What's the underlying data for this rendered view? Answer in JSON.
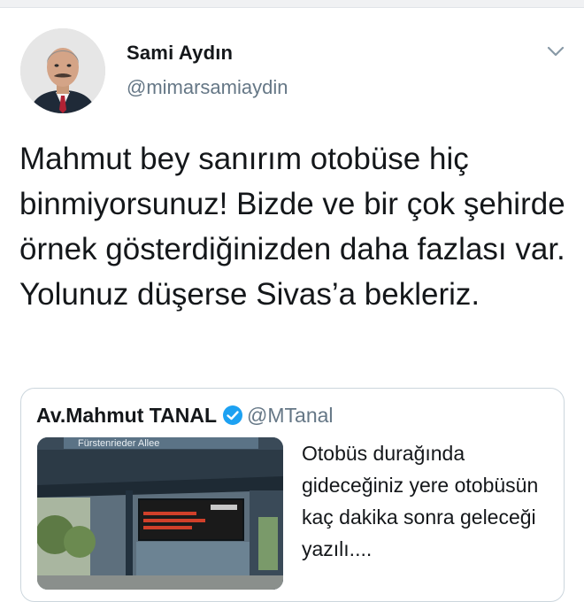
{
  "tweet": {
    "author": {
      "display_name": "Sami Aydın",
      "handle": "@mimarsamiaydin",
      "avatar_icon": "profile-photo"
    },
    "menu_icon": "chevron-down-icon",
    "text": "Mahmut bey sanırım otobüse hiç binmiyorsunuz! Bizde ve bir çok şehirde örnek gösterdiğinizden daha fazlası var. Yolunuz düşerse Sivas’a bekleriz."
  },
  "quoted_tweet": {
    "display_name": "Av.Mahmut TANAL",
    "verified_icon": "verified-badge-icon",
    "handle": "@MTanal",
    "text": "Otobüs durağında gideceğiniz yere otobüsün kaç dakika sonra geleceği yazılı....",
    "image": {
      "description_icon": "bus-stop-photo",
      "sign_text": "Fürstenrieder Allee"
    }
  },
  "colors": {
    "text_primary": "#14171a",
    "text_secondary": "#657786",
    "verified_blue": "#1da1f2",
    "border": "#ccd6dd"
  }
}
